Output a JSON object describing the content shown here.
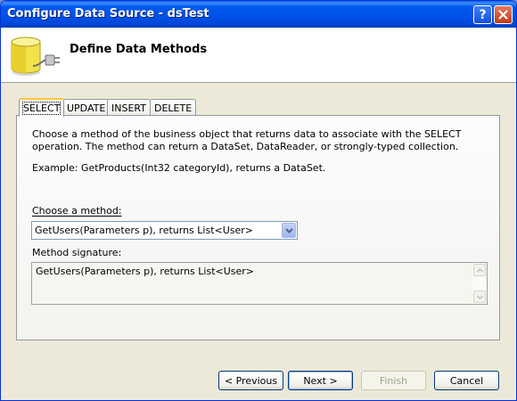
{
  "window": {
    "title": "Configure Data Source - dsTest",
    "help_glyph": "?",
    "close_glyph": "✕"
  },
  "header": {
    "title": "Define Data Methods",
    "icon": "database-plug-icon"
  },
  "tabs": [
    {
      "label": "SELECT",
      "active": true
    },
    {
      "label": "UPDATE",
      "active": false
    },
    {
      "label": "INSERT",
      "active": false
    },
    {
      "label": "DELETE",
      "active": false
    }
  ],
  "select_tab": {
    "description": "Choose a method of the business object that returns data to associate with the SELECT operation. The method can return a DataSet, DataReader, or strongly-typed collection.",
    "example": "Example: GetProducts(Int32 categoryId), returns a DataSet.",
    "choose_method_label": "Choose a method:",
    "choose_method_value": "GetUsers(Parameters p), returns List<User>",
    "method_signature_label": "Method signature:",
    "method_signature_value": "GetUsers(Parameters p), returns List<User>"
  },
  "buttons": {
    "previous": "< Previous",
    "next": "Next >",
    "finish": "Finish",
    "cancel": "Cancel"
  },
  "colors": {
    "titlebar": "#0054e3",
    "dialog_bg": "#ece9d8",
    "active_tab_highlight": "#ffc83c"
  }
}
